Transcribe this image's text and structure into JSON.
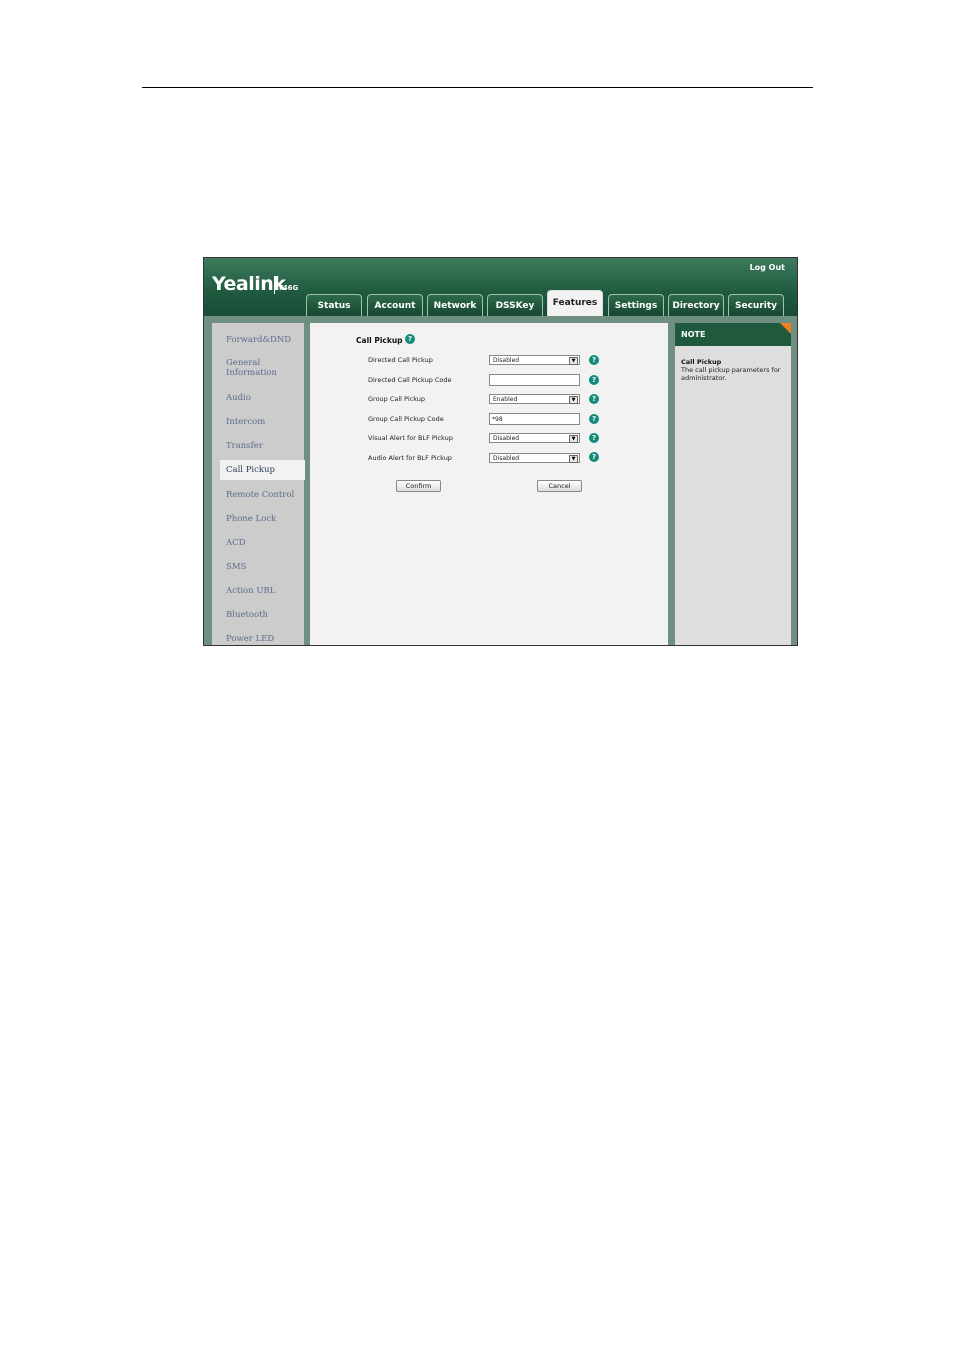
{
  "app": {
    "brand": "Yealink",
    "model": "T46G",
    "logout_label": "Log Out"
  },
  "tabs": [
    {
      "label": "Status",
      "active": false
    },
    {
      "label": "Account",
      "active": false
    },
    {
      "label": "Network",
      "active": false
    },
    {
      "label": "DSSKey",
      "active": false
    },
    {
      "label": "Features",
      "active": true
    },
    {
      "label": "Settings",
      "active": false
    },
    {
      "label": "Directory",
      "active": false
    },
    {
      "label": "Security",
      "active": false
    }
  ],
  "sidebar": {
    "items": [
      {
        "label": "Forward&DND"
      },
      {
        "label": "General Information"
      },
      {
        "label": "Audio"
      },
      {
        "label": "Intercom"
      },
      {
        "label": "Transfer"
      },
      {
        "label": "Call Pickup",
        "active": true
      },
      {
        "label": "Remote Control"
      },
      {
        "label": "Phone Lock"
      },
      {
        "label": "ACD"
      },
      {
        "label": "SMS"
      },
      {
        "label": "Action URL"
      },
      {
        "label": "Bluetooth"
      },
      {
        "label": "Power LED"
      }
    ]
  },
  "form": {
    "title": "Call Pickup",
    "fields": [
      {
        "label": "Directed Call Pickup",
        "type": "select",
        "value": "Disabled"
      },
      {
        "label": "Directed Call Pickup Code",
        "type": "text",
        "value": ""
      },
      {
        "label": "Group Call Pickup",
        "type": "select",
        "value": "Enabled"
      },
      {
        "label": "Group Call Pickup Code",
        "type": "text",
        "value": "*98"
      },
      {
        "label": "Visual Alert for BLF Pickup",
        "type": "select",
        "value": "Disabled"
      },
      {
        "label": "Audio Alert for BLF Pickup",
        "type": "select",
        "value": "Disabled"
      }
    ],
    "confirm_label": "Confirm",
    "cancel_label": "Cancel"
  },
  "note": {
    "header": "NOTE",
    "title": "Call Pickup",
    "text": "The call pickup parameters for administrator."
  },
  "colors": {
    "header_green": "#1f5a3f",
    "help_icon": "#128b7a",
    "note_corner": "#f07f1e"
  }
}
